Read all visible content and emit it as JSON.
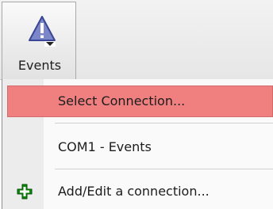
{
  "ribbon": {
    "events_button": {
      "label": "Events",
      "icon": "warning-triangle-dropdown-icon",
      "icon_colors": {
        "fill": "#7b87c9",
        "stroke": "#3a4596",
        "exclamation": "#ffffff"
      }
    }
  },
  "menu": {
    "items": [
      {
        "label": "Select Connection...",
        "highlighted": true,
        "highlight_color": "#f08080"
      },
      {
        "label": "COM1 - Events"
      },
      {
        "label": "Add/Edit a connection...",
        "icon": "green-plus-icon",
        "icon_color": "#0b8a0b"
      }
    ]
  }
}
